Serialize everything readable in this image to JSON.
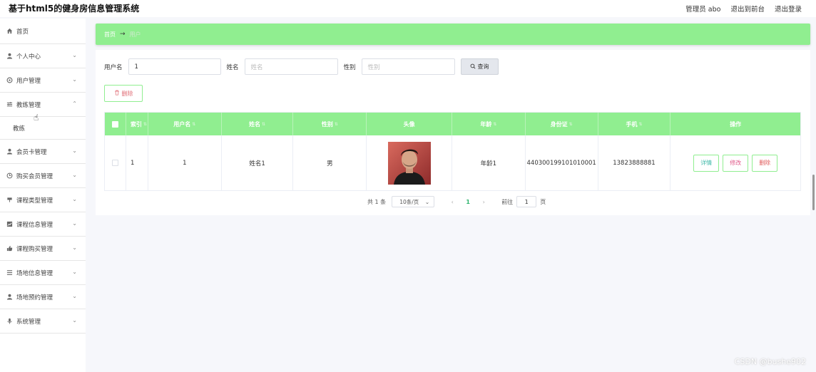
{
  "header": {
    "title": "基于html5的健身房信息管理系统",
    "admin": "管理员 abo",
    "to_front": "退出到前台",
    "logout": "退出登录"
  },
  "sidebar": {
    "items": [
      {
        "label": "首页",
        "icon": "home-icon",
        "has_chevron": false
      },
      {
        "label": "个人中心",
        "icon": "user-icon",
        "has_chevron": true
      },
      {
        "label": "用户管理",
        "icon": "gear-icon",
        "has_chevron": true
      },
      {
        "label": "教练管理",
        "icon": "sliders-icon",
        "has_chevron": true,
        "expanded": true,
        "children": [
          "教练"
        ]
      },
      {
        "label": "会员卡管理",
        "icon": "user-icon",
        "has_chevron": true
      },
      {
        "label": "购买会员管理",
        "icon": "clock-icon",
        "has_chevron": true
      },
      {
        "label": "课程类型管理",
        "icon": "flag-icon",
        "has_chevron": true
      },
      {
        "label": "课程信息管理",
        "icon": "chart-icon",
        "has_chevron": true
      },
      {
        "label": "课程购买管理",
        "icon": "thumbs-up-icon",
        "has_chevron": true
      },
      {
        "label": "场地信息管理",
        "icon": "list-icon",
        "has_chevron": true
      },
      {
        "label": "场地预约管理",
        "icon": "user-icon",
        "has_chevron": true
      },
      {
        "label": "系统管理",
        "icon": "mic-icon",
        "has_chevron": true
      }
    ]
  },
  "breadcrumb": {
    "home": "首页",
    "current": "用户"
  },
  "search": {
    "username_label": "用户名",
    "username_value": "1",
    "name_label": "姓名",
    "name_placeholder": "姓名",
    "sex_label": "性别",
    "sex_placeholder": "性别",
    "query_label": "查询"
  },
  "actions": {
    "delete_label": "删除"
  },
  "table": {
    "columns": [
      "索引",
      "用户名",
      "姓名",
      "性别",
      "头像",
      "年龄",
      "身份证",
      "手机",
      "操作"
    ],
    "rows": [
      {
        "index": "1",
        "username": "1",
        "name": "姓名1",
        "sex": "男",
        "age": "年龄1",
        "id_card": "440300199101010001",
        "phone": "13823888881",
        "ops": {
          "detail": "详情",
          "edit": "修改",
          "delete": "删除"
        }
      }
    ]
  },
  "pagination": {
    "total": "共 1 条",
    "page_size": "10条/页",
    "current_page": "1",
    "goto_prefix": "前往",
    "goto_value": "1",
    "goto_suffix": "页"
  },
  "watermark": "CSDN @bushe902",
  "colors": {
    "accent": "#90ee90",
    "header_bg": "#ffffff",
    "page_bg": "#f6f7fb"
  }
}
